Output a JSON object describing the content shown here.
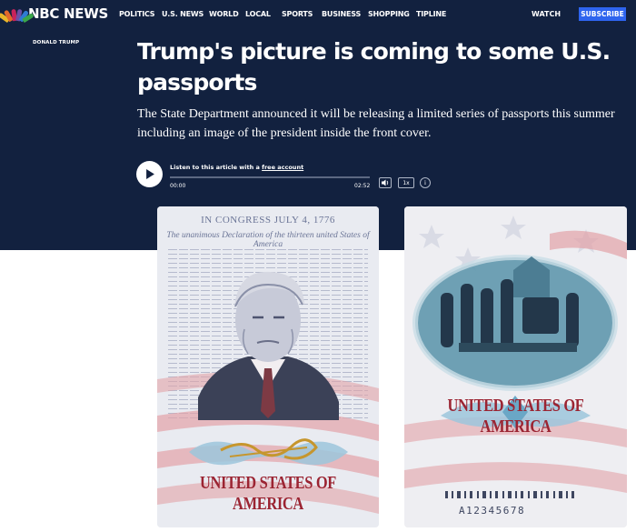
{
  "brand": {
    "name": "NBC NEWS"
  },
  "nav": {
    "items": [
      "POLITICS",
      "U.S. NEWS",
      "WORLD",
      "LOCAL",
      "SPORTS",
      "BUSINESS",
      "SHOPPING",
      "TIPLINE"
    ],
    "watch": "WATCH",
    "subscribe": "SUBSCRIBE"
  },
  "article": {
    "tag": "DONALD TRUMP",
    "headline": "Trump's picture is coming to some U.S. passports",
    "dek": "The State Department announced it will be releasing a limited series of passports this summer including an image of the president inside the front cover."
  },
  "player": {
    "listen_prefix": "Listen to this article with a ",
    "listen_link": "free account",
    "current_time": "00:00",
    "duration": "02:52",
    "speed": "1x",
    "info": "i",
    "progress": 0
  },
  "passport_left": {
    "congress": "IN CONGRESS  JULY 4, 1776",
    "declaration": "The unanimous Declaration of the thirteen united States of America",
    "country": "UNITED STATES OF AMERICA"
  },
  "passport_right": {
    "country": "UNITED STATES OF AMERICA",
    "number": "A12345678"
  },
  "colors": {
    "header_bg": "#12213f",
    "subscribe_bg": "#2e64ee",
    "passport_red": "#9b2432",
    "signature_gold": "#c6962d"
  },
  "icons": {
    "play": "play-icon",
    "volume": "volume-icon",
    "info": "info-icon",
    "logo": "peacock-icon"
  }
}
